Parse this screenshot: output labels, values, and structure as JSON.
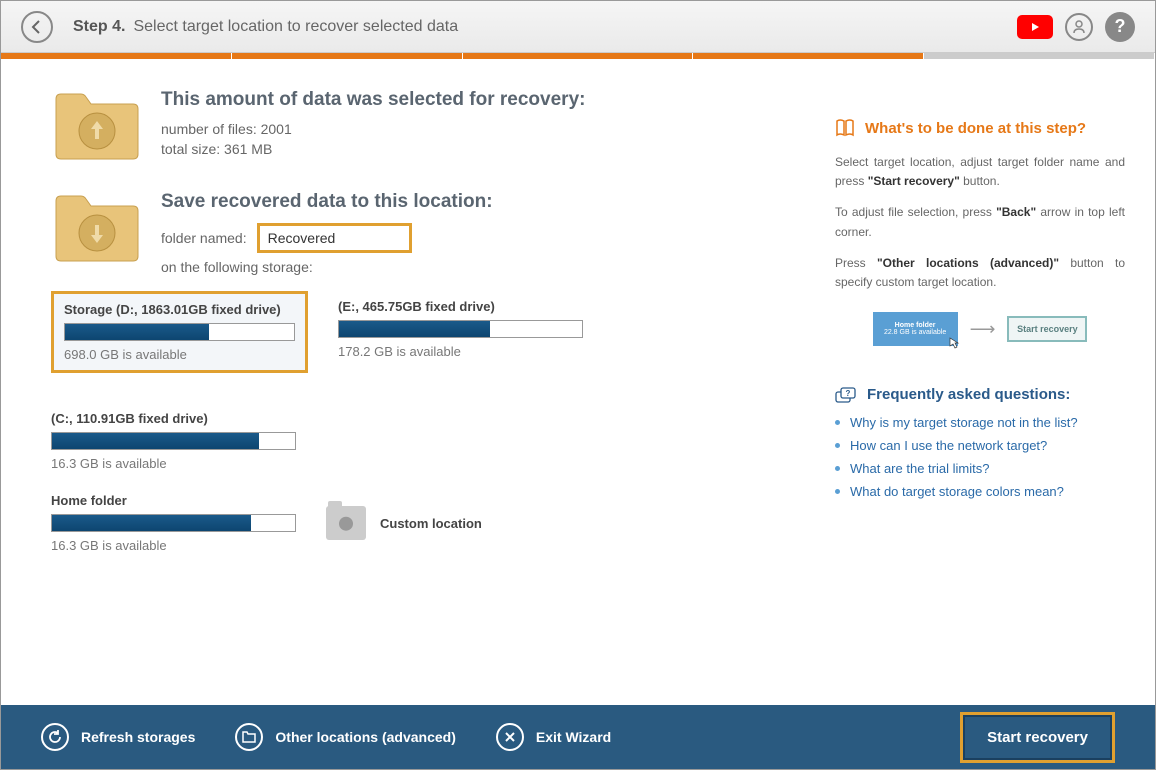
{
  "header": {
    "step_label": "Step 4.",
    "step_desc": "Select target location to recover selected data"
  },
  "recovery_info": {
    "title": "This amount of data was selected for recovery:",
    "files_line": "number of files: 2001",
    "size_line": "total size: 361 MB"
  },
  "save_location": {
    "title": "Save recovered data to this location:",
    "folder_label": "folder named:",
    "folder_value": "Recovered",
    "storage_label": "on the following storage:"
  },
  "storages": [
    {
      "name": "Storage (D:, 1863.01GB fixed drive)",
      "available": "698.0 GB is available",
      "fill_pct": 63,
      "selected": true
    },
    {
      "name": "(E:, 465.75GB fixed drive)",
      "available": "178.2 GB is available",
      "fill_pct": 62,
      "selected": false
    },
    {
      "name": "(C:, 110.91GB fixed drive)",
      "available": "16.3 GB is available",
      "fill_pct": 85,
      "selected": false
    }
  ],
  "storages_row2": [
    {
      "name": "Home folder",
      "available": "16.3 GB is available",
      "fill_pct": 82
    }
  ],
  "custom_location_label": "Custom location",
  "hints": {
    "title": "What's to be done at this step?",
    "p1_a": "Select target location, adjust target folder name and press ",
    "p1_b": "\"Start recovery\"",
    "p1_c": " button.",
    "p2_a": "To adjust file selection, press ",
    "p2_b": "\"Back\"",
    "p2_c": " arrow in top left corner.",
    "p3_a": "Press ",
    "p3_b": "\"Other locations (advanced)\"",
    "p3_c": " button to specify custom target location.",
    "hint_box1_a": "Home folder",
    "hint_box1_b": "22.8 GB is available",
    "hint_box2": "Start recovery"
  },
  "faq": {
    "title": "Frequently asked questions:",
    "items": [
      "Why is my target storage not in the list?",
      "How can I use the network target?",
      "What are the trial limits?",
      "What do target storage colors mean?"
    ]
  },
  "footer": {
    "refresh": "Refresh storages",
    "other": "Other locations (advanced)",
    "exit": "Exit Wizard",
    "start": "Start recovery"
  }
}
